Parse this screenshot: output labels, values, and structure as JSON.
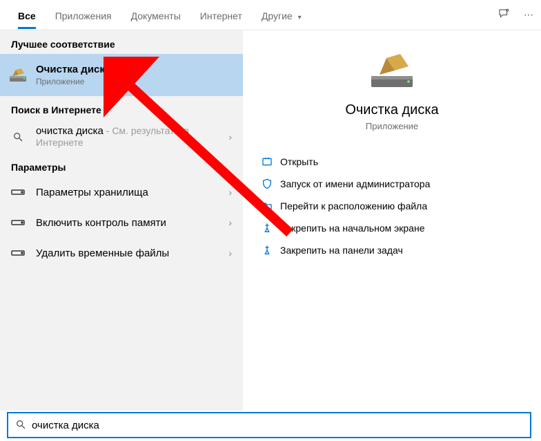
{
  "tabs": {
    "all": "Все",
    "apps": "Приложения",
    "docs": "Документы",
    "web": "Интернет",
    "other": "Другие"
  },
  "left": {
    "best_header": "Лучшее соответствие",
    "best": {
      "title": "Очистка диска",
      "sub": "Приложение"
    },
    "web_header": "Поиск в Интернете",
    "web": {
      "title": "очистка диска",
      "hint_dash": " - ",
      "hint": "См. результаты в Интернете"
    },
    "settings_header": "Параметры",
    "settings": [
      "Параметры хранилища",
      "Включить контроль памяти",
      "Удалить временные файлы"
    ]
  },
  "right": {
    "title": "Очистка диска",
    "type": "Приложение",
    "actions": [
      "Открыть",
      "Запуск от имени администратора",
      "Перейти к расположению файла",
      "Закрепить на начальном экране",
      "Закрепить на панели задач"
    ]
  },
  "search": {
    "value": "очистка диска"
  }
}
